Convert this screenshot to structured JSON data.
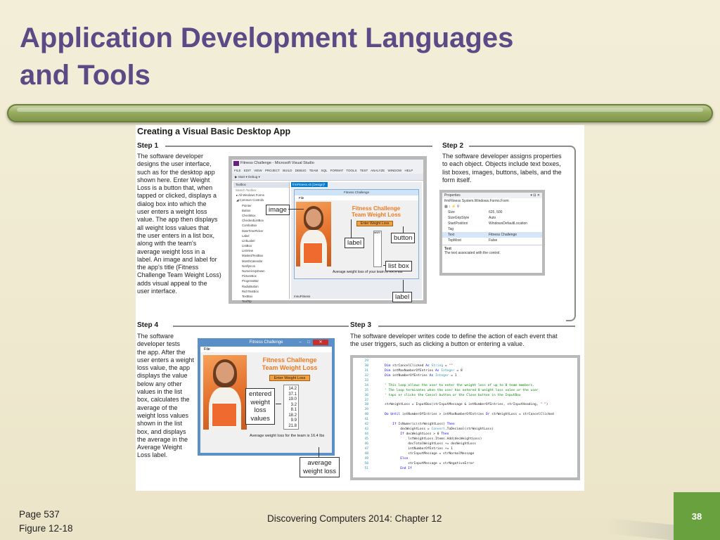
{
  "slide": {
    "title_line1": "Application Development Languages",
    "title_line2": "and Tools",
    "footer_page": "Page 537",
    "footer_figure": "Figure 12-18",
    "footer_center": "Discovering Computers 2014: Chapter 12",
    "page_number": "38",
    "colors": {
      "title": "#5a4a86",
      "accent_bar": "#8aa24e",
      "page_box": "#6aa13f",
      "app_orange": "#ef7a22"
    }
  },
  "figure": {
    "heading": "Creating a Visual Basic Desktop App",
    "step1": {
      "label": "Step 1",
      "lines": [
        "The software developer",
        "designs the user interface,",
        "such as for the desktop app",
        "shown here. Enter Weight",
        "Loss is a button that, when",
        "tapped or clicked, displays a",
        "dialog box into which the",
        "user enters a weight loss",
        "value. The app then displays",
        "all weight loss values that",
        "the user enters in a list box,",
        "along with the team's",
        "average weight loss in a",
        "label. An image and label for",
        "the app's title (Fitness",
        "Challenge Team Weight Loss)",
        "adds visual appeal to the",
        "user interface."
      ]
    },
    "step2": {
      "label": "Step 2",
      "lines": [
        "The software developer assigns properties",
        "to each object. Objects include text boxes,",
        "list boxes, images, buttons, labels, and the",
        "form itself."
      ]
    },
    "step3": {
      "label": "Step 3",
      "lines": [
        "The software developer writes code to define the action of each event that",
        "the user triggers, such as clicking a button or entering a value."
      ]
    },
    "step4": {
      "label": "Step 4",
      "lines": [
        "The software",
        "developer tests",
        "the app. After the",
        "user enters a weight",
        "loss value, the app",
        "displays the value",
        "below any other",
        "values in the list",
        "box, calculates the",
        "average of the",
        "weight loss values",
        "shown in the list",
        "box, and displays",
        "the average in the",
        "Average Weight",
        "Loss label."
      ]
    },
    "callouts": {
      "image": "image",
      "label_top": "label",
      "button": "button",
      "list_box": "list box",
      "label_bottom": "label",
      "entered_weight_loss_values": [
        "entered",
        "weight",
        "loss",
        "values"
      ],
      "average_weight_loss": [
        "average",
        "weight loss"
      ]
    },
    "vs_window": {
      "title": "Fitness Challenge - Microsoft Visual Studio",
      "menu": "FILE EDIT VIEW PROJECT BUILD DEBUG TEAM SQL FORMAT TOOLS TEST ANALYZE WINDOW HELP",
      "toolbar": "▶ Start  ▾  Debug ▾",
      "toolbox_title": "Toolbox",
      "toolbox_search": "Search Toolbox",
      "toolbox_groups": [
        "All Windows Forms",
        "Common Controls"
      ],
      "toolbox_items": [
        "Pointer",
        "Button",
        "CheckBox",
        "CheckedListBox",
        "ComboBox",
        "DateTimePicker",
        "Label",
        "LinkLabel",
        "ListBox",
        "ListView",
        "MaskedTextBox",
        "MonthCalendar",
        "NotifyIcon",
        "NumericUpDown",
        "PictureBox",
        "ProgressBar",
        "RadioButton",
        "RichTextBox",
        "TextBox",
        "ToolTip"
      ],
      "design_tab": "frmFitness.vb [Design]*",
      "form_title": "Fitness Challenge",
      "form_menu": "File",
      "app_title_line1": "Fitness Challenge",
      "app_title_line2": "Team Weight Loss",
      "button_text": "Enter Weight Loss",
      "listbox_text": "lstWV",
      "avg_label": "Average weight loss of your team is XX.X lbs",
      "component_tray": "mnuFitness"
    },
    "properties_window": {
      "title": "Properties",
      "object": "frmFitness  System.Windows.Forms.Form",
      "rows": [
        {
          "k": "Size",
          "v": "625, 500",
          "sel": false
        },
        {
          "k": "SizeGripStyle",
          "v": "Auto",
          "sel": false
        },
        {
          "k": "StartPosition",
          "v": "WindowsDefaultLocation",
          "sel": false
        },
        {
          "k": "Tag",
          "v": "",
          "sel": false
        },
        {
          "k": "Text",
          "v": "Fitness Challenge",
          "sel": true
        },
        {
          "k": "TopMost",
          "v": "False",
          "sel": false
        }
      ],
      "desc_title": "Text",
      "desc": "The text associated with the control."
    },
    "code": {
      "lines": [
        {
          "n": "29",
          "t": ""
        },
        {
          "n": "30",
          "t": "    Dim strCancelClicked As String = \"\""
        },
        {
          "n": "31",
          "t": "    Dim intMaxNumberOfEntries As Integer = 8"
        },
        {
          "n": "32",
          "t": "    Dim intNumberOfEntries As Integer = 1"
        },
        {
          "n": "33",
          "t": ""
        },
        {
          "n": "34",
          "t": "    ' This loop allows the user to enter the weight loss of up to 8 team members."
        },
        {
          "n": "35",
          "t": "    ' The loop terminates when the user has entered 8 weight loss vales or the user"
        },
        {
          "n": "36",
          "t": "    ' taps or clicks the Cancel button or the Close button in the InputBox"
        },
        {
          "n": "37",
          "t": ""
        },
        {
          "n": "38",
          "t": "    strWeightLoss = InputBox(strInputMessage & intNumberOfEntries, strInputHeading, \" \")"
        },
        {
          "n": "39",
          "t": ""
        },
        {
          "n": "40",
          "t": "    Do Until intNumberOfEntries > intMaxNumberOfEntries Or strWeightLoss = strCancelClicked"
        },
        {
          "n": "41",
          "t": ""
        },
        {
          "n": "42",
          "t": "        If IsNumeric(strWeightLoss) Then"
        },
        {
          "n": "43",
          "t": "            decWeightLoss = Convert.ToDecimal(strWeightLoss)"
        },
        {
          "n": "44",
          "t": "            If decWeightLoss > 0 Then"
        },
        {
          "n": "45",
          "t": "                lstWeightLoss.Items.Add(decWeightLoss)"
        },
        {
          "n": "46",
          "t": "                decTotalWeightLoss += decWeightLoss"
        },
        {
          "n": "47",
          "t": "                intNumberOfEntries += 1"
        },
        {
          "n": "48",
          "t": "                strInputMessage = strNormalMessage"
        },
        {
          "n": "49",
          "t": "            Else"
        },
        {
          "n": "50",
          "t": "                strInputMessage = strNegativeError"
        },
        {
          "n": "51",
          "t": "            End If"
        }
      ]
    },
    "running_app": {
      "title": "Fitness Challenge",
      "menu": "File",
      "title_line1": "Fitness Challenge",
      "title_line2": "Team Weight Loss",
      "button_text": "Enter Weight Loss",
      "list_values": [
        "14.2",
        "37.1",
        "19.0",
        "3.2",
        "8.1",
        "18.2",
        "9.9",
        "21.8"
      ],
      "avg_label": "Average weight loss for the team is 16.4 lbs"
    }
  }
}
